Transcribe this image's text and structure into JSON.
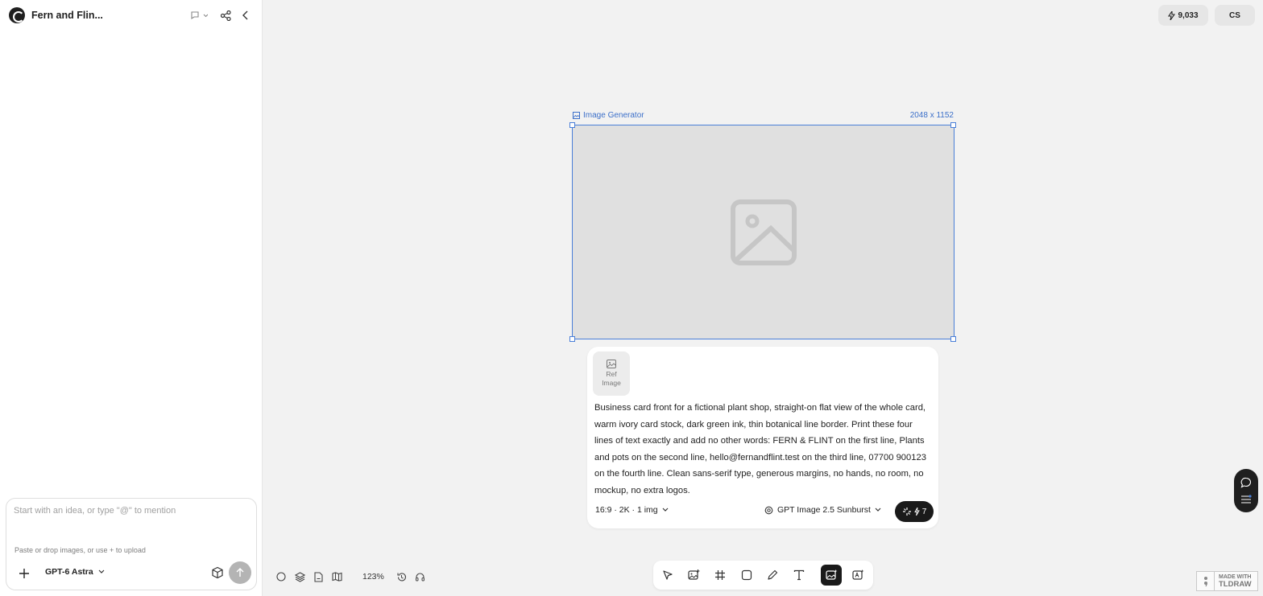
{
  "sidebar": {
    "project_title": "Fern and Flin...",
    "composer_placeholder": "Start with an idea, or type \"@\" to mention",
    "composer_hint": "Paste or drop images, or use + to upload",
    "model_label": "GPT-6 Astra"
  },
  "topbar": {
    "credits": "9,033",
    "avatar_initials": "CS"
  },
  "frame": {
    "label": "Image Generator",
    "dimensions": "2048 x 1152"
  },
  "prompt_card": {
    "ref_image_label_1": "Ref",
    "ref_image_label_2": "Image",
    "prompt": "Business card front for a fictional plant shop, straight-on flat view of the whole card, warm ivory card stock, dark green ink, thin botanical line border. Print these four lines of text exactly and add no other words: FERN & FLINT on the first line, Plants and pots on the second line, hello@fernandflint.test on the third line, 07700 900123 on the fourth line. Clean sans-serif type, generous margins, no hands, no room, no mockup, no extra logos.",
    "settings": "16:9 · 2K · 1 img",
    "image_model": "GPT Image 2.5 Sunburst",
    "cost": "7"
  },
  "bottom_controls": {
    "zoom": "123%"
  },
  "watermark": {
    "line1": "MADE WITH",
    "line2": "TLDRAW"
  },
  "colors": {
    "accent_blue": "#4a7fd8",
    "dark": "#1a1a1a"
  }
}
